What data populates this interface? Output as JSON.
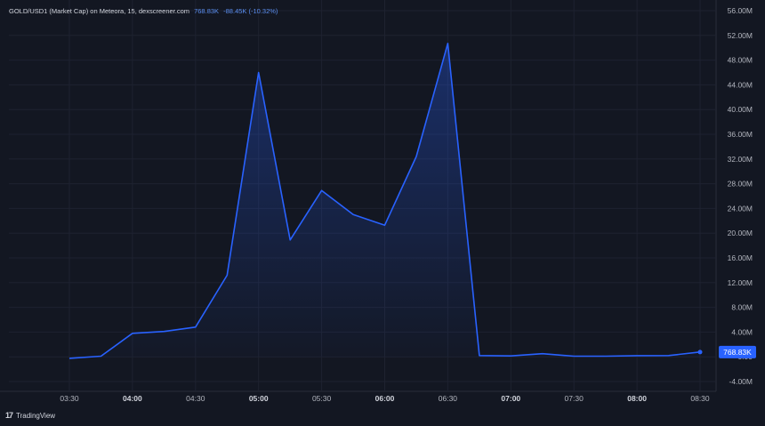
{
  "header": {
    "symbol": "GOLD/USD1 (Market Cap) on Meteora, 15, dexscreener.com",
    "last_value": "768.83K",
    "change": "-88.45K (-10.32%)"
  },
  "footer": {
    "logo": "17",
    "brand": "TradingView"
  },
  "colors": {
    "background": "#131722",
    "line": "#2962ff",
    "badge": "#2962ff",
    "text": "#b2b5be",
    "grid": "#1e2230"
  },
  "chart_data": {
    "type": "area",
    "x": [
      "03:30",
      "03:45",
      "04:00",
      "04:15",
      "04:30",
      "04:45",
      "05:00",
      "05:15",
      "05:30",
      "05:45",
      "06:00",
      "06:15",
      "06:30",
      "06:45",
      "07:00",
      "07:15",
      "07:30",
      "07:45",
      "08:00",
      "08:15",
      "08:30"
    ],
    "series": [
      {
        "values": [
          -0.25,
          0.1,
          3.8,
          4.1,
          4.8,
          13.2,
          46.0,
          18.9,
          26.9,
          23.0,
          21.3,
          32.4,
          50.7,
          0.2,
          0.15,
          0.5,
          0.1,
          0.1,
          0.18,
          0.2,
          0.77
        ]
      }
    ],
    "ylim": [
      -4,
      56
    ],
    "y_ticks": [
      "56.00M",
      "52.00M",
      "48.00M",
      "44.00M",
      "40.00M",
      "36.00M",
      "32.00M",
      "28.00M",
      "24.00M",
      "20.00M",
      "16.00M",
      "12.00M",
      "8.00M",
      "4.00M",
      "0.00",
      "-4.00M"
    ],
    "x_tick_labels": [
      "03:30",
      "04:00",
      "04:30",
      "05:00",
      "05:30",
      "06:00",
      "06:30",
      "07:00",
      "07:30",
      "08:00",
      "08:30"
    ],
    "last_value_label": "768.83K",
    "last_value": 0.76883,
    "grid": true
  }
}
